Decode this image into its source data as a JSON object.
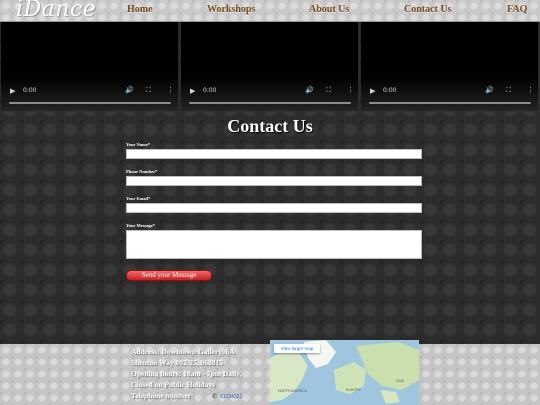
{
  "header": {
    "logo": "iDance",
    "nav": [
      "Home",
      "Workshops",
      "About Us",
      "Contact Us",
      "FAQ"
    ]
  },
  "videos": [
    {
      "time": "0:00"
    },
    {
      "time": "0:00"
    },
    {
      "time": "0:00"
    }
  ],
  "contact": {
    "title": "Contact Us",
    "fields": {
      "name_label": "Your Name*",
      "phone_label": "Phone Number*",
      "email_label": "Your Email*",
      "message_label": "Your Message*"
    },
    "submit_label": "Send your Messsge"
  },
  "footer": {
    "address_lines": [
      "Address: Downtown Gallery, 6A",
      "Shenton Way #02-25, 068815",
      "Opening hours: 10am - 7pm Daily,",
      "Closed on Public Holidays",
      "Telephone number:"
    ],
    "phone_link": "61234321"
  },
  "map": {
    "view_larger": "View larger map",
    "labels": [
      "NORTH AMERICA",
      "EUROPE",
      "ASIA"
    ]
  },
  "colors": {
    "nav_text": "#7a4e1f",
    "submit_bg": "#d63a3a",
    "page_bg": "#2c2c2c"
  }
}
